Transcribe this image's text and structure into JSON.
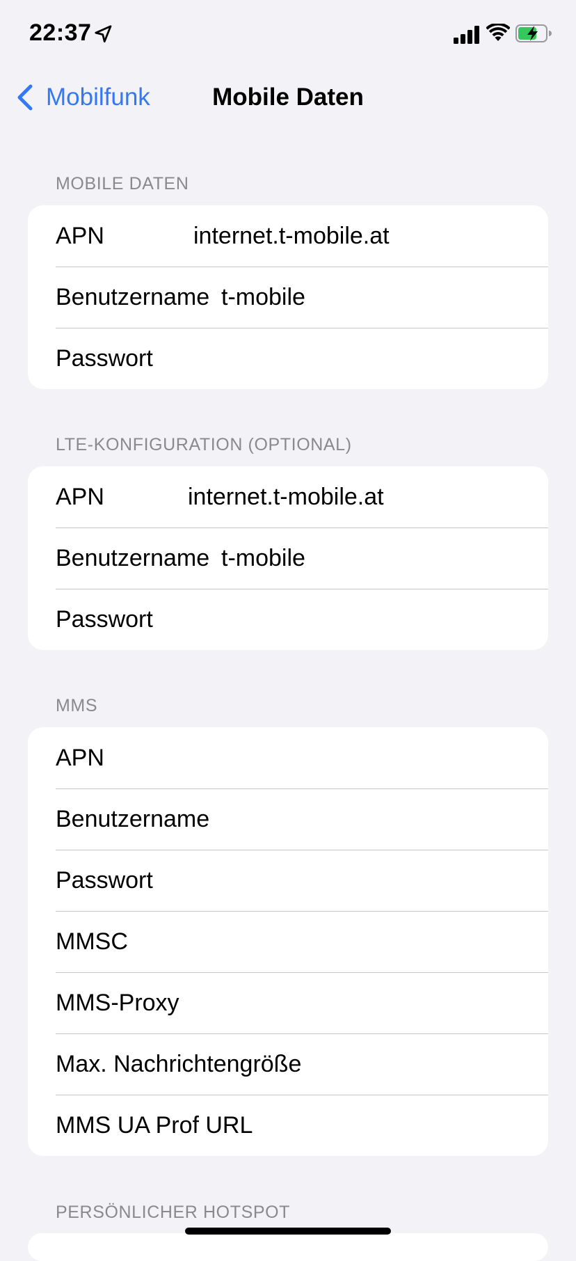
{
  "status_bar": {
    "time": "22:37",
    "icons": [
      "location-arrow-icon",
      "cellular-signal-icon",
      "wifi-icon",
      "battery-charging-icon"
    ]
  },
  "nav": {
    "back_label": "Mobilfunk",
    "title": "Mobile Daten"
  },
  "sections": {
    "mobile_data": {
      "header": "MOBILE DATEN",
      "apn_label": "APN",
      "apn_value": "internet.t-mobile.at",
      "username_label": "Benutzername",
      "username_value": "t-mobile",
      "password_label": "Passwort"
    },
    "lte": {
      "header": "LTE-KONFIGURATION (OPTIONAL)",
      "apn_label": "APN",
      "apn_value": "internet.t-mobile.at",
      "username_label": "Benutzername",
      "username_value": "t-mobile",
      "password_label": "Passwort"
    },
    "mms": {
      "header": "MMS",
      "rows": [
        "APN",
        "Benutzername",
        "Passwort",
        "MMSC",
        "MMS-Proxy",
        "Max. Nachrichtengröße",
        "MMS UA Prof URL"
      ]
    },
    "hotspot": {
      "header": "PERSÖNLICHER HOTSPOT"
    }
  },
  "colors": {
    "accent": "#3478f6",
    "background": "#f2f2f7",
    "section_header": "#8a8a8e",
    "separator": "#c6c6c8",
    "battery_fill": "#34c759"
  }
}
